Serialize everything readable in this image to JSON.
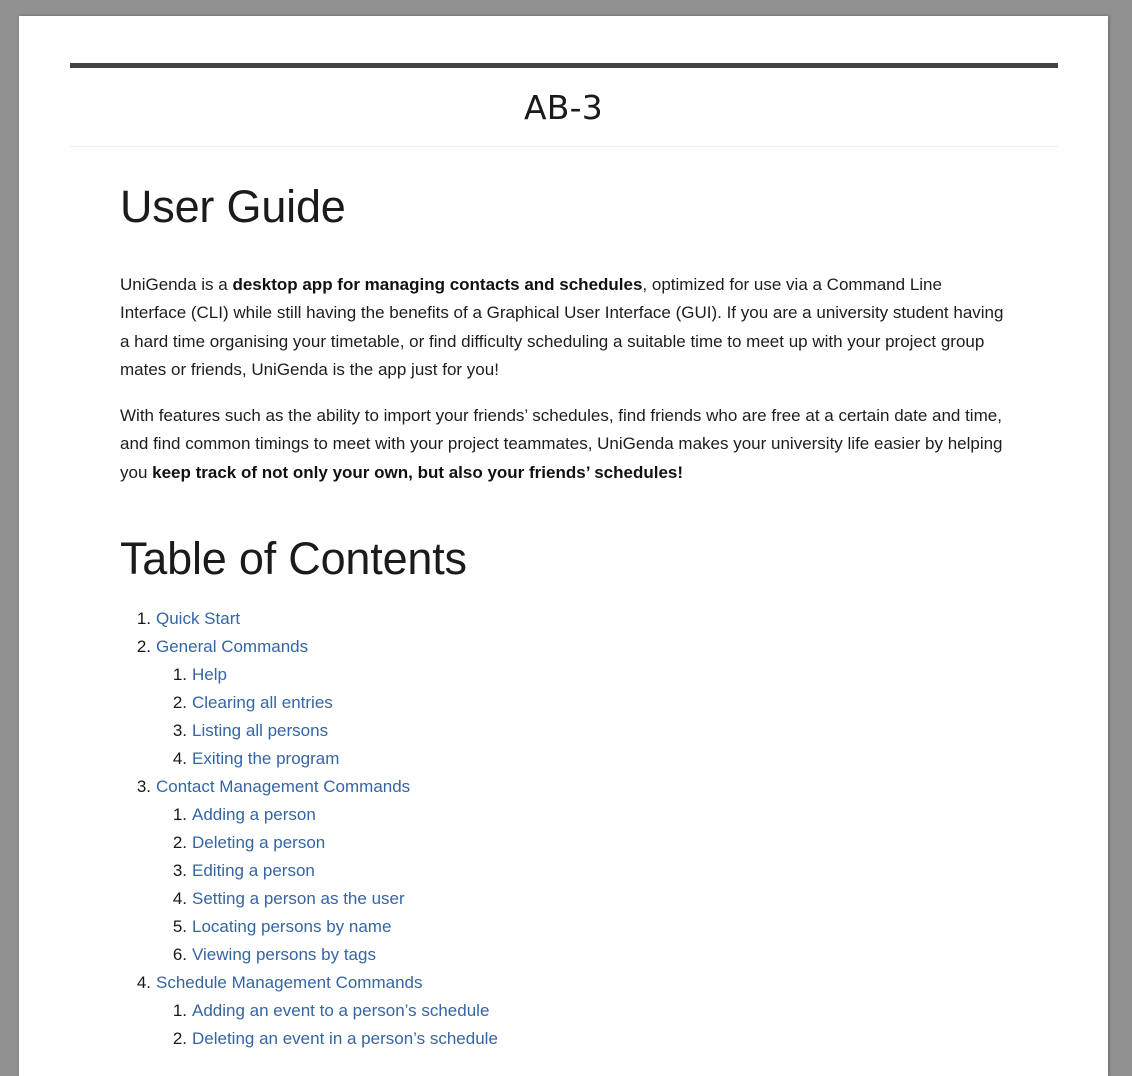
{
  "page": {
    "background_color": "#909090",
    "sheet_color": "#ffffff",
    "link_color": "#3465a4",
    "rule_color": "#424242",
    "thin_rule_color": "#eeeeee"
  },
  "header": {
    "title": "AB-3"
  },
  "user_guide": {
    "heading": "User Guide",
    "paragraph_1": {
      "part_1": "UniGenda is a ",
      "bold_1": "desktop app for managing contacts and schedules",
      "part_2": ", optimized for use via a Command Line Interface (CLI) while still having the benefits of a Graphical User Interface (GUI). If you are a university student having a hard time organising your timetable, or find difficulty scheduling a suitable time to meet up with your project group mates or friends, UniGenda is the app just for you!"
    },
    "paragraph_2": {
      "part_1": "With features such as the ability to import your friends’ schedules, find friends who are free at a certain date and time, and find common timings to meet with your project teammates, UniGenda makes your university life easier by helping you ",
      "bold_1": "keep track of not only your own, but also your friends’ schedules!"
    }
  },
  "toc": {
    "heading": "Table of Contents",
    "items": [
      {
        "level": 1,
        "marker": "1.",
        "label": "Quick Start"
      },
      {
        "level": 1,
        "marker": "2.",
        "label": "General Commands"
      },
      {
        "level": 2,
        "marker": "1.",
        "label": "Help"
      },
      {
        "level": 2,
        "marker": "2.",
        "label": "Clearing all entries"
      },
      {
        "level": 2,
        "marker": "3.",
        "label": "Listing all persons"
      },
      {
        "level": 2,
        "marker": "4.",
        "label": "Exiting the program"
      },
      {
        "level": 1,
        "marker": "3.",
        "label": "Contact Management Commands"
      },
      {
        "level": 2,
        "marker": "1.",
        "label": "Adding a person"
      },
      {
        "level": 2,
        "marker": "2.",
        "label": "Deleting a person"
      },
      {
        "level": 2,
        "marker": "3.",
        "label": "Editing a person"
      },
      {
        "level": 2,
        "marker": "4.",
        "label": "Setting a person as the user"
      },
      {
        "level": 2,
        "marker": "5.",
        "label": "Locating persons by name"
      },
      {
        "level": 2,
        "marker": "6.",
        "label": "Viewing persons by tags"
      },
      {
        "level": 1,
        "marker": "4.",
        "label": "Schedule Management Commands"
      },
      {
        "level": 2,
        "marker": "1.",
        "label": "Adding an event to a person’s schedule"
      },
      {
        "level": 2,
        "marker": "2.",
        "label": "Deleting an event in a person’s schedule"
      }
    ]
  }
}
